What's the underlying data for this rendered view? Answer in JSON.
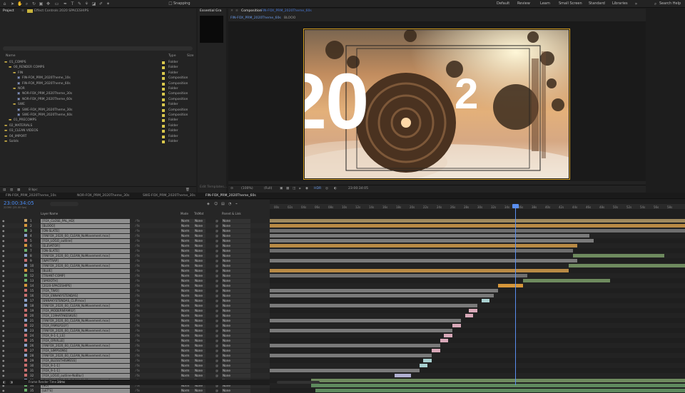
{
  "toolbar": {
    "snapping_label": "Snapping",
    "workspaces": [
      "Default",
      "Review",
      "Learn",
      "Small Screen",
      "Standard",
      "Libraries"
    ],
    "search_placeholder": "Search Help"
  },
  "project_panel": {
    "tab_project": "Project",
    "tab_effects": "Effect Controls 2020 SPACESHIPS",
    "col_name": "Name",
    "col_type": "Type",
    "col_size": "Size",
    "rows": [
      {
        "name": "01_COMPS",
        "type": "Folder"
      },
      {
        "name": "00_RENDER COMPS",
        "type": "Folder"
      },
      {
        "name": "FIN",
        "type": "Folder"
      },
      {
        "name": "FIN-FOX_PRM_2020Theme_10s",
        "type": "Composition"
      },
      {
        "name": "FIN-FOX_PRM_2020Theme_60s",
        "type": "Composition"
      },
      {
        "name": "NOR",
        "type": "Folder"
      },
      {
        "name": "NOR-FOX_PRM_2020Theme_30s",
        "type": "Composition"
      },
      {
        "name": "NOR-FOX_PRM_2020Theme_60s",
        "type": "Composition"
      },
      {
        "name": "SWE",
        "type": "Folder"
      },
      {
        "name": "SWE-FOX_PRM_2020Theme_30s",
        "type": "Composition"
      },
      {
        "name": "SWE-FOX_PRM_2020Theme_60s",
        "type": "Composition"
      },
      {
        "name": "01_PRECOMPS",
        "type": "Folder"
      },
      {
        "name": "02_MATERIALS",
        "type": "Folder"
      },
      {
        "name": "03_CLEAN VIDEOS",
        "type": "Folder"
      },
      {
        "name": "04_IMPORT",
        "type": "Folder"
      },
      {
        "name": "Solids",
        "type": "Folder"
      }
    ],
    "footer": "8 bpc"
  },
  "essential_graphics": {
    "tab": "Essential Gra",
    "footer": "Edit Templates..."
  },
  "viewer": {
    "tab_label": "Composition",
    "tab_name": "FIN-FOX_PRM_2020Theme_60s",
    "breadcrumb_comp": "FIN-FOX_PRM_2020Theme_60s",
    "breadcrumb_layer": "BLOOO",
    "zoom": "(100%)",
    "resolution": "(Full)",
    "timecode": "23:00:34:05",
    "overlay_text": "20"
  },
  "timeline": {
    "tabs": [
      "FIN-FOX_PRM_2020Theme_10s",
      "NOR-FOX_PRM_2020Theme_30s",
      "SWE-FOX_PRM_2020Theme_30s",
      "FIN-FOX_PRM_2020Theme_60s"
    ],
    "timecode": "23:00:34:05",
    "fps_info": "22390 (25.00 fps)",
    "col_layer_name": "Layer Name",
    "col_mode": "Mode",
    "col_trkmat": "TrkMat",
    "col_parent": "Parent & Link",
    "ruler": [
      "00s",
      "02s",
      "04s",
      "06s",
      "08s",
      "10s",
      "12s",
      "14s",
      "16s",
      "18s",
      "20s",
      "22s",
      "24s",
      "26s",
      "28s",
      "30s",
      "32s",
      "34s",
      "36s",
      "38s",
      "40s",
      "42s",
      "44s",
      "46s",
      "48s",
      "50s",
      "52s",
      "54s",
      "56s",
      "58s"
    ],
    "footer_label": "Frame Render Time",
    "footer_value": "34ms",
    "layers": [
      {
        "num": "1",
        "name": "[FOX_CLOSE_PAL_HD]",
        "mode": "Norm",
        "trk": "None",
        "parent": "None",
        "color": "#c9a66b",
        "bar": {
          "s": 0.0,
          "e": 1.0,
          "c": "#a08a5e"
        }
      },
      {
        "num": "2",
        "name": "[BLOOO]",
        "mode": "Norm",
        "trk": "None",
        "parent": "None",
        "color": "#d6963a",
        "bar": {
          "s": 0.0,
          "e": 1.0,
          "c": "#b88a45"
        }
      },
      {
        "num": "3",
        "name": "[ON-SLATE]",
        "mode": "Norm",
        "trk": "None",
        "parent": "None",
        "color": "#6bb06b",
        "bar": {
          "s": 0.0,
          "e": 1.0,
          "c": "#6e6e6e"
        }
      },
      {
        "num": "4",
        "name": "[FINFOX_2020_60_CLEAN_NoMovement.mov]",
        "mode": "Norm",
        "trk": "None",
        "parent": "None",
        "color": "#8aa0c8",
        "bar": {
          "s": 0.0,
          "e": 0.77,
          "c": "#7a7a7a"
        }
      },
      {
        "num": "5",
        "name": "[FOX_LOGO_outline]",
        "mode": "Norm",
        "trk": "None",
        "parent": "None",
        "color": "#c86e6e",
        "bar": {
          "s": 0.0,
          "e": 0.78,
          "c": "#7a7a7a"
        }
      },
      {
        "num": "6",
        "name": "[ELEVATOR]",
        "mode": "Norm",
        "trk": "None",
        "parent": "None",
        "color": "#d6963a",
        "bar": {
          "s": 0.0,
          "e": 0.74,
          "c": "#b88a45"
        }
      },
      {
        "num": "7",
        "name": "[ON-SLATE]",
        "mode": "Norm",
        "trk": "None",
        "parent": "None",
        "color": "#6bb06b",
        "bar": {
          "s": 0.0,
          "e": 0.73,
          "c": "#6e6e6e"
        }
      },
      {
        "num": "8",
        "name": "[FINFOX_2020_60_CLEAN_NoMovement.mov]",
        "mode": "Norm",
        "trk": "None",
        "parent": "None",
        "color": "#8aa0c8",
        "bar": {
          "s": 0.73,
          "e": 0.95,
          "c": "#6e8a5e"
        }
      },
      {
        "num": "9",
        "name": "[WAYTRAP]",
        "mode": "Norm",
        "trk": "None",
        "parent": "None",
        "color": "#c86e6e",
        "bar": {
          "s": 0.0,
          "e": 0.74,
          "c": "#7a7a7a"
        }
      },
      {
        "num": "10",
        "name": "[FINFOX_2020_60_CLEAN_NoMovement.mov]",
        "mode": "Norm",
        "trk": "None",
        "parent": "None",
        "color": "#8aa0c8",
        "bar": {
          "s": 0.72,
          "e": 1.0,
          "c": "#6e8a5e"
        }
      },
      {
        "num": "11",
        "name": "[BLUE]",
        "mode": "Norm",
        "trk": "None",
        "parent": "None",
        "color": "#d6963a",
        "bar": {
          "s": 0.0,
          "e": 0.72,
          "c": "#b88a45"
        }
      },
      {
        "num": "12",
        "name": "[TRIANT-COMP]",
        "mode": "Norm",
        "trk": "None",
        "parent": "None",
        "color": "#6bb06b",
        "bar": {
          "s": 0.0,
          "e": 0.62,
          "c": "#6e6e6e"
        }
      },
      {
        "num": "13",
        "name": "[SMOOTH]",
        "mode": "Norm",
        "trk": "None",
        "parent": "None",
        "color": "#6bb06b",
        "bar": {
          "s": 0.61,
          "e": 0.82,
          "c": "#6e8a5e"
        }
      },
      {
        "num": "14",
        "name": "[2020-SPACESHIPS]",
        "mode": "Norm",
        "trk": "None",
        "parent": "None",
        "color": "#d6963a",
        "bar": {
          "s": 0.55,
          "e": 0.61,
          "c": "#d6963a"
        }
      },
      {
        "num": "15",
        "name": "[FOX_TWO]",
        "mode": "Norm",
        "trk": "None",
        "parent": "None",
        "color": "#c86e6e",
        "bar": {
          "s": 0.0,
          "e": 0.55,
          "c": "#7a7a7a"
        }
      },
      {
        "num": "16",
        "name": "[FOX_ENNAKYSTENDAS]",
        "mode": "Norm",
        "trk": "None",
        "parent": "None",
        "color": "#c86e6e",
        "bar": {
          "s": 0.0,
          "e": 0.54,
          "c": "#7a7a7a"
        }
      },
      {
        "num": "17",
        "name": "[ENNAKYSTENDAS_CLIP.mov]",
        "mode": "Norm",
        "trk": "None",
        "parent": "None",
        "color": "#8aa0c8",
        "bar": {
          "s": 0.51,
          "e": 0.53,
          "c": "#a9d0d0"
        }
      },
      {
        "num": "18",
        "name": "[FINFOX_2020_60_CLEAN_NoMovement.mov]",
        "mode": "Norm",
        "trk": "None",
        "parent": "None",
        "color": "#8aa0c8",
        "bar": {
          "s": 0.0,
          "e": 0.5,
          "c": "#7a7a7a"
        }
      },
      {
        "num": "19",
        "name": "[FOX_MODERNFAMILY]",
        "mode": "Norm",
        "trk": "None",
        "parent": "None",
        "color": "#c86e6e",
        "bar": {
          "s": 0.48,
          "e": 0.5,
          "c": "#d8a8b8"
        }
      },
      {
        "num": "20",
        "name": "[FOX_119HATAKESKUS]",
        "mode": "Norm",
        "trk": "None",
        "parent": "None",
        "color": "#c86e6e",
        "bar": {
          "s": 0.47,
          "e": 0.49,
          "c": "#d8a8b8"
        }
      },
      {
        "num": "21",
        "name": "[FINFOX_2020_60_CLEAN_NoMovement.mov]",
        "mode": "Norm",
        "trk": "None",
        "parent": "None",
        "color": "#8aa0c8",
        "bar": {
          "s": 0.0,
          "e": 0.46,
          "c": "#7a7a7a"
        }
      },
      {
        "num": "22",
        "name": "[FOX_FAMILYGUY]",
        "mode": "Norm",
        "trk": "None",
        "parent": "None",
        "color": "#c86e6e",
        "bar": {
          "s": 0.44,
          "e": 0.46,
          "c": "#d8a8b8"
        }
      },
      {
        "num": "23",
        "name": "[FINFOX_2020_60_CLEAN_NoMovement.mov]",
        "mode": "Norm",
        "trk": "None",
        "parent": "None",
        "color": "#8aa0c8",
        "bar": {
          "s": 0.0,
          "e": 0.44,
          "c": "#7a7a7a"
        }
      },
      {
        "num": "24",
        "name": "[FOX_9-1-1_LS]",
        "mode": "Norm",
        "trk": "None",
        "parent": "None",
        "color": "#c86e6e",
        "bar": {
          "s": 0.42,
          "e": 0.44,
          "c": "#d8a8b8"
        }
      },
      {
        "num": "25",
        "name": "[FOX_ORVILLE]",
        "mode": "Norm",
        "trk": "None",
        "parent": "None",
        "color": "#c86e6e",
        "bar": {
          "s": 0.41,
          "e": 0.43,
          "c": "#d8a8b8"
        }
      },
      {
        "num": "26",
        "name": "[FINFOX_2020_60_CLEAN_NoMovement.mov]",
        "mode": "Norm",
        "trk": "None",
        "parent": "None",
        "color": "#8aa0c8",
        "bar": {
          "s": 0.0,
          "e": 0.41,
          "c": "#7a7a7a"
        }
      },
      {
        "num": "27",
        "name": "[FOX_SIMPSONS]",
        "mode": "Norm",
        "trk": "None",
        "parent": "None",
        "color": "#c86e6e",
        "bar": {
          "s": 0.39,
          "e": 0.41,
          "c": "#d8a8b8"
        }
      },
      {
        "num": "28",
        "name": "[FINFOX_2020_60_CLEAN_NoMovement.mov]",
        "mode": "Norm",
        "trk": "None",
        "parent": "None",
        "color": "#8aa0c8",
        "bar": {
          "s": 0.0,
          "e": 0.39,
          "c": "#7a7a7a"
        }
      },
      {
        "num": "29",
        "name": "[FOX_BLESSTHISMESS]",
        "mode": "Norm",
        "trk": "None",
        "parent": "None",
        "color": "#c86e6e",
        "bar": {
          "s": 0.37,
          "e": 0.39,
          "c": "#a9d0d0"
        }
      },
      {
        "num": "30",
        "name": "[FOX_9-1-1]",
        "mode": "Norm",
        "trk": "None",
        "parent": "None",
        "color": "#c86e6e",
        "bar": {
          "s": 0.36,
          "e": 0.38,
          "c": "#a9d0d0"
        }
      },
      {
        "num": "31",
        "name": "[FOX_9-1-1]",
        "mode": "Norm",
        "trk": "None",
        "parent": "None",
        "color": "#c86e6e",
        "bar": {
          "s": 0.0,
          "e": 0.36,
          "c": "#7a7a7a"
        }
      },
      {
        "num": "32",
        "name": "[FOX_LOGO_outline-NoBlur]",
        "mode": "Norm",
        "trk": "None",
        "parent": "None",
        "color": "#c86e6e",
        "bar": {
          "s": 0.3,
          "e": 0.34,
          "c": "#b0b0d0"
        }
      },
      {
        "num": "33",
        "name": "[FINFOX_2020_60_CLEAN_NoMovement.mov]",
        "mode": "Norm",
        "trk": "None",
        "parent": "None",
        "color": "#8aa0c8",
        "bar": {
          "s": 0.1,
          "e": 1.0,
          "c": "#6e8a5e"
        }
      },
      {
        "num": "34",
        "name": "[SO]",
        "mode": "Norm",
        "trk": "None",
        "parent": "None",
        "color": "#6bb06b",
        "bar": {
          "s": 0.1,
          "e": 1.0,
          "c": "#5e8a5e"
        }
      },
      {
        "num": "35",
        "name": "[LET'S]",
        "mode": "Norm",
        "trk": "None",
        "parent": "None",
        "color": "#6bb06b",
        "bar": {
          "s": 0.11,
          "e": 1.0,
          "c": "#5e8a5e"
        }
      }
    ]
  },
  "colors": {
    "accent": "#4a7ad8",
    "playhead": "#5a8ff0"
  }
}
